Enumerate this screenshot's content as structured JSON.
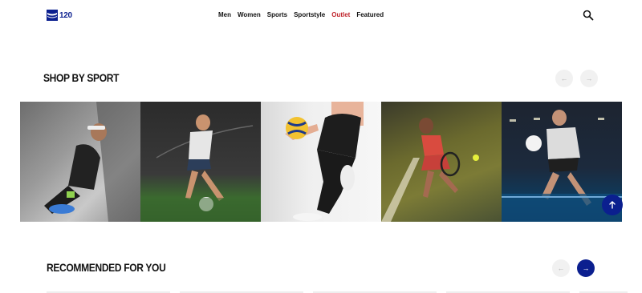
{
  "header": {
    "logo_text": "120",
    "nav": [
      {
        "label": "Men"
      },
      {
        "label": "Women"
      },
      {
        "label": "Sports"
      },
      {
        "label": "Sportstyle"
      },
      {
        "label": "Outlet"
      },
      {
        "label": "Featured"
      }
    ]
  },
  "shop_by_sport": {
    "title": "SHOP BY SPORT",
    "prev_icon": "arrow-left-icon",
    "next_icon": "arrow-right-icon",
    "tiles": [
      {
        "image": "running-athlete-lacing-shoe"
      },
      {
        "image": "football-player-kicking-ball"
      },
      {
        "image": "volleyball-player-holding-ball"
      },
      {
        "image": "tennis-player-on-court"
      },
      {
        "image": "handball-player-with-ball"
      }
    ]
  },
  "back_to_top_icon": "arrow-up-icon",
  "recommended": {
    "title": "RECOMMENDED FOR YOU",
    "prev_icon": "arrow-left-icon",
    "next_icon": "arrow-right-icon"
  },
  "colors": {
    "brand": "#0b1f8f",
    "outlet": "#c0262d",
    "disabled_button": "#f1f1f1"
  }
}
